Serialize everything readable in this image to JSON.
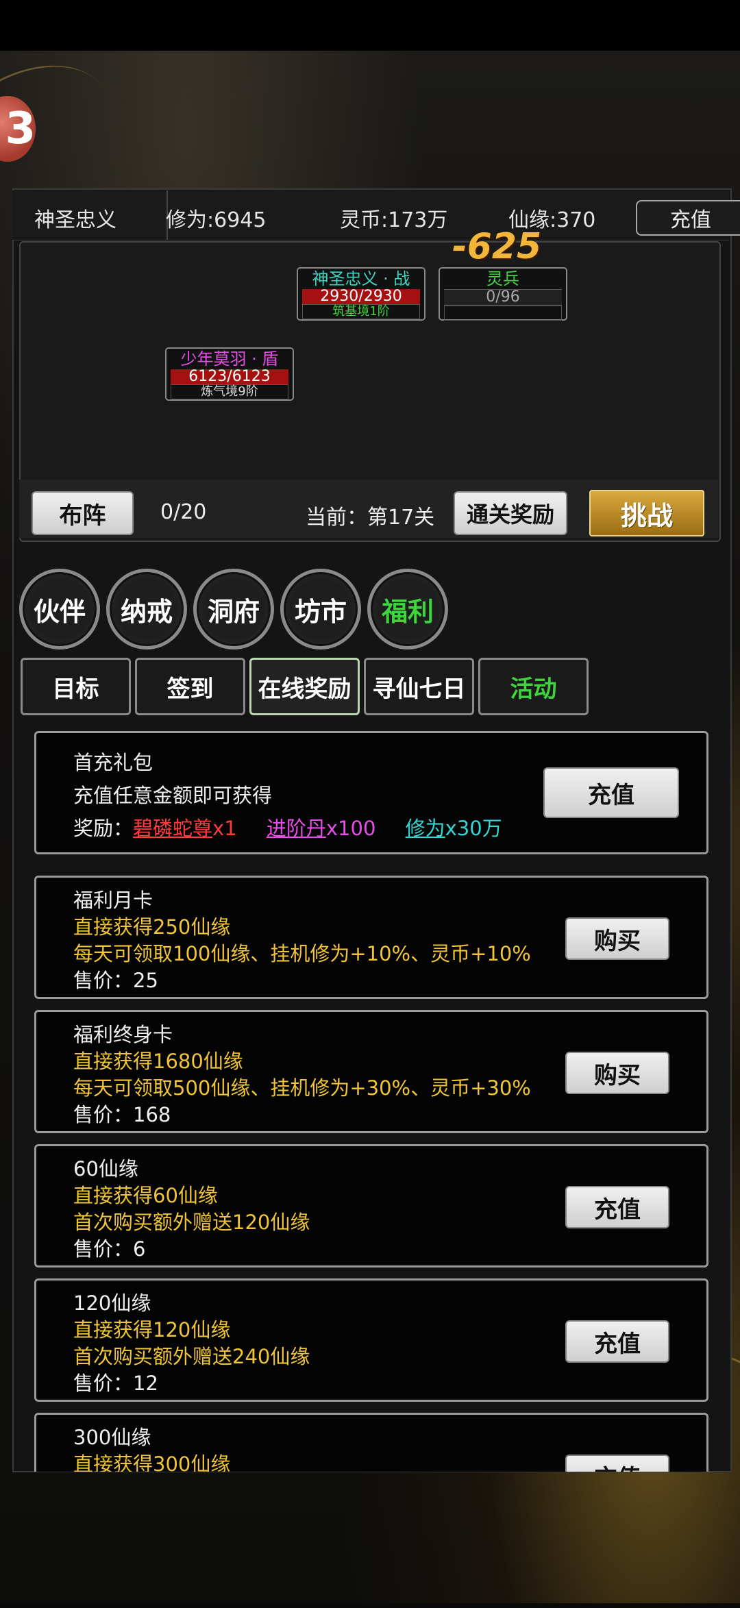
{
  "stats": {
    "name": "神圣忠义",
    "cultivation": "修为:6945",
    "spirit_coin": "灵币:173万",
    "xianyuan": "仙缘:370",
    "recharge_label": "充值"
  },
  "battle": {
    "ally_name": "神圣忠义 · 战",
    "ally_hp": "2930/2930",
    "ally_rank": "筑基境1阶",
    "enemy_name": "灵兵",
    "enemy_hp": "0/96",
    "damage": "-625",
    "partner_name": "少年莫羽 · 盾",
    "partner_hp": "6123/6123",
    "partner_rank": "炼气境9阶",
    "formation_label": "布阵",
    "progress": "0/20",
    "current_level": "当前：第17关",
    "clear_reward_label": "通关奖励",
    "challenge_label": "挑战"
  },
  "main_tabs": [
    {
      "label": "伙伴"
    },
    {
      "label": "纳戒"
    },
    {
      "label": "洞府"
    },
    {
      "label": "坊市"
    },
    {
      "label": "福利"
    }
  ],
  "sub_tabs": [
    {
      "label": "目标"
    },
    {
      "label": "签到"
    },
    {
      "label": "在线奖励"
    },
    {
      "label": "寻仙七日"
    },
    {
      "label": "活动"
    }
  ],
  "first_recharge": {
    "title": "首充礼包",
    "desc": "充值任意金额即可获得",
    "reward_prefix": "奖励：",
    "reward1_name": "碧磷蛇尊",
    "reward1_qty": "x1",
    "reward2_name": "进阶丹",
    "reward2_qty": "x100",
    "reward3_name": "修为",
    "reward3_qty": "x30万",
    "button": "充值"
  },
  "cards": [
    {
      "title": "福利月卡",
      "line1": "直接获得250仙缘",
      "line2": "每天可领取100仙缘、挂机修为+10%、灵币+10%",
      "price": "售价：25",
      "button": "购买"
    },
    {
      "title": "福利终身卡",
      "line1": "直接获得1680仙缘",
      "line2": "每天可领取500仙缘、挂机修为+30%、灵币+30%",
      "price": "售价：168",
      "button": "购买"
    },
    {
      "title": "60仙缘",
      "line1": "直接获得60仙缘",
      "line2": "首次购买额外赠送120仙缘",
      "price": "售价：6",
      "button": "充值"
    },
    {
      "title": "120仙缘",
      "line1": "直接获得120仙缘",
      "line2": "首次购买额外赠送240仙缘",
      "price": "售价：12",
      "button": "充值"
    },
    {
      "title": "300仙缘",
      "line1": "直接获得300仙缘",
      "button": "充值"
    }
  ],
  "colors": {
    "accent_green": "#3ed43e",
    "gold_text": "#f0c437",
    "hp_red": "#a61010",
    "challenge_gold": "#d9a93e"
  }
}
